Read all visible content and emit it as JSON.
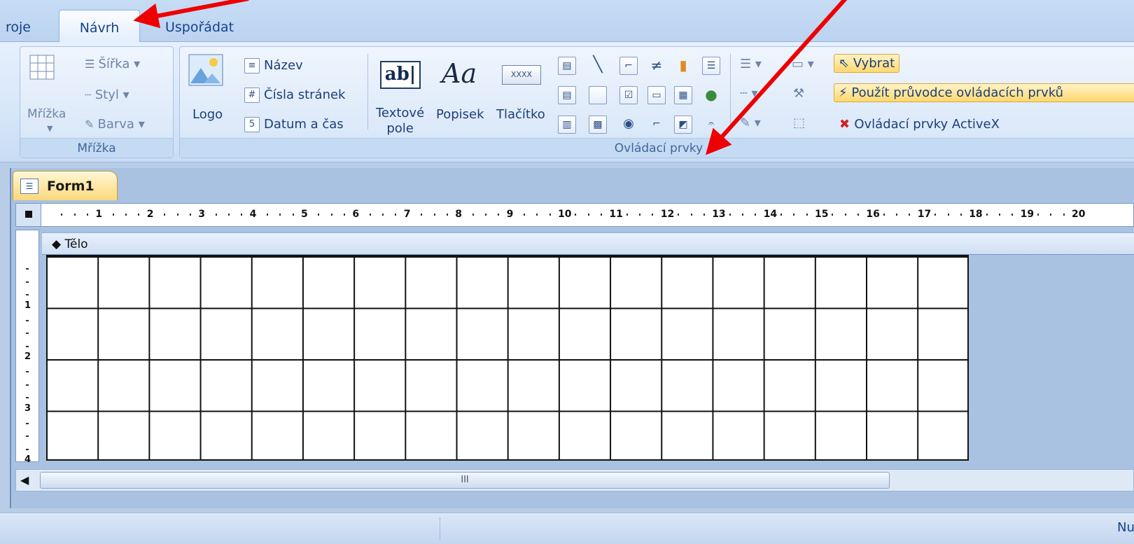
{
  "tabs": [
    {
      "label": "roje",
      "active": false
    },
    {
      "label": "Návrh",
      "active": true
    },
    {
      "label": "Uspořádat",
      "active": false
    }
  ],
  "ribbon": {
    "grid_group": {
      "label": "Mřížka",
      "big_button": "Mřížka",
      "width": "Šířka",
      "style": "Styl",
      "color": "Barva"
    },
    "controls_group": {
      "label": "Ovládací prvky",
      "logo": "Logo",
      "title": "Název",
      "page_numbers": "Čísla stránek",
      "date_time": "Datum a čas",
      "textbox_line1": "Textové",
      "textbox_line2": "pole",
      "label_button": "Popisek",
      "button_button": "Tlačítko",
      "aa_glyph": "Aa",
      "ab_glyph": "ab|",
      "xxxx_glyph": "XXXX",
      "select": "Vybrat",
      "use_wizards": "Použít průvodce ovládacích prvků",
      "activex": "Ovládací prvky ActiveX"
    }
  },
  "document": {
    "tab_title": "Form1",
    "ruler_numbers": [
      "1",
      "2",
      "3",
      "4",
      "5",
      "6",
      "7",
      "8",
      "9",
      "10",
      "11",
      "12",
      "13",
      "14",
      "15",
      "16",
      "17",
      "18",
      "19",
      "20"
    ],
    "vruler_numbers": [
      "1",
      "2",
      "3",
      "4"
    ],
    "section_title": "Tělo",
    "scroll_thumb_glyph": "III"
  },
  "status": {
    "right_text": "Nu"
  },
  "colors": {
    "annotation_arrow": "#ee0000",
    "accent": "#15428b"
  }
}
